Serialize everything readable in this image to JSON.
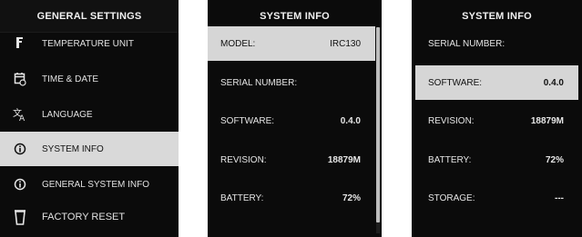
{
  "panel1": {
    "title": "GENERAL SETTINGS",
    "items": [
      {
        "label": "TEMPERATURE UNIT",
        "icon": "thermometer-icon"
      },
      {
        "label": "TIME & DATE",
        "icon": "calendar-clock-icon"
      },
      {
        "label": "LANGUAGE",
        "icon": "translate-icon"
      },
      {
        "label": "SYSTEM INFO",
        "icon": "info-icon"
      },
      {
        "label": "GENERAL SYSTEM INFO",
        "icon": "info-icon"
      },
      {
        "label": "FACTORY RESET",
        "icon": "trash-icon"
      }
    ]
  },
  "panel2": {
    "title": "SYSTEM INFO",
    "rows": [
      {
        "label": "MODEL:",
        "value": "IRC130"
      },
      {
        "label": "SERIAL NUMBER:",
        "value": ""
      },
      {
        "label": "SOFTWARE:",
        "value": "0.4.0"
      },
      {
        "label": "REVISION:",
        "value": "18879M"
      },
      {
        "label": "BATTERY:",
        "value": "72%"
      }
    ]
  },
  "panel3": {
    "title": "SYSTEM INFO",
    "rows": [
      {
        "label": "SERIAL NUMBER:",
        "value": ""
      },
      {
        "label": "SOFTWARE:",
        "value": "0.4.0"
      },
      {
        "label": "REVISION:",
        "value": "18879M"
      },
      {
        "label": "BATTERY:",
        "value": "72%"
      },
      {
        "label": "STORAGE:",
        "value": "---"
      }
    ]
  },
  "colors": {
    "panel_bg": "#0b0b0b",
    "highlight": "#d9d9d9",
    "text": "#e6e6e6"
  }
}
